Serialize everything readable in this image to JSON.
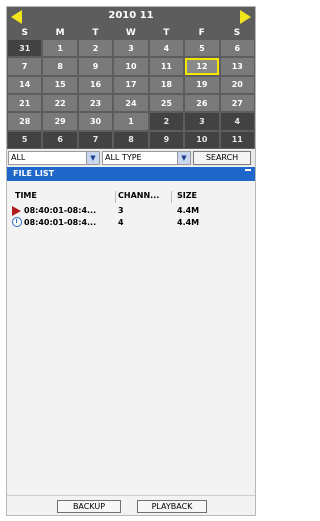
{
  "calendar": {
    "month_label": "2010  11",
    "weekdays": [
      "S",
      "M",
      "T",
      "W",
      "T",
      "F",
      "S"
    ],
    "days": [
      "31",
      "1",
      "2",
      "3",
      "4",
      "5",
      "6",
      "7",
      "8",
      "9",
      "10",
      "11",
      "12",
      "13",
      "14",
      "15",
      "16",
      "17",
      "18",
      "19",
      "20",
      "21",
      "22",
      "23",
      "24",
      "25",
      "26",
      "27",
      "28",
      "29",
      "30",
      "1",
      "2",
      "3",
      "4",
      "5",
      "6",
      "7",
      "8",
      "9",
      "10",
      "11"
    ],
    "selected_day": "12"
  },
  "filters": {
    "channel_value": "ALL",
    "type_value": "ALL TYPE",
    "search_label": "SEARCH"
  },
  "file_list": {
    "title": "FILE LIST",
    "columns": [
      "TIME",
      "CHANN...",
      "SIZE"
    ],
    "rows": [
      {
        "icon": "play-icon",
        "time": "08:40:01-08:4...",
        "channel": "3",
        "size": "4.4M"
      },
      {
        "icon": "clock-icon",
        "time": "08:40:01-08:4...",
        "channel": "4",
        "size": "4.4M"
      }
    ]
  },
  "buttons": {
    "backup": "BACKUP",
    "playback": "PLAYBACK"
  },
  "colors": {
    "accent_blue": "#1f67c9",
    "arrow_yellow": "#f2e51d",
    "selection_yellow": "#f5e600",
    "calendar_bg": "#5d5d5d"
  }
}
